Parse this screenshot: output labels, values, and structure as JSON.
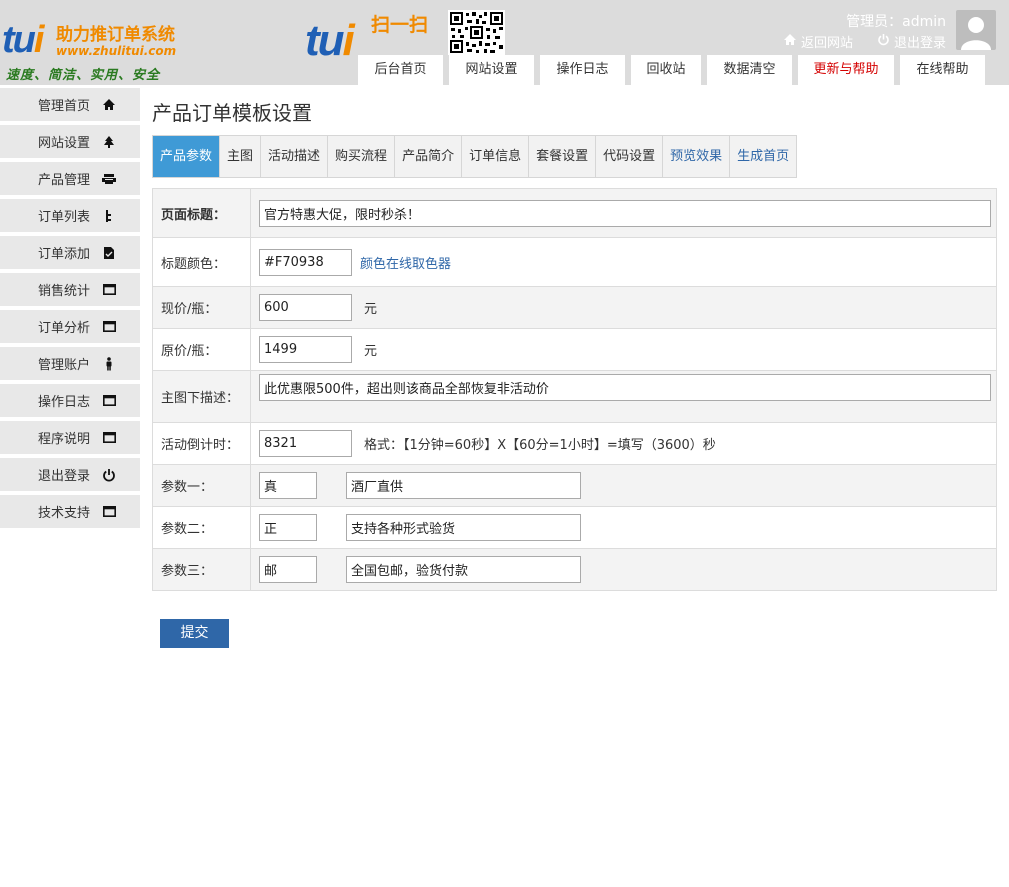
{
  "header": {
    "logo": {
      "brand": "tui",
      "title": "助力推订单系统",
      "url": "www.zhulitui.com",
      "slogan": "速度、简洁、实用、安全"
    },
    "scan": {
      "brand": "tui",
      "text": "扫一扫"
    },
    "admin_label": "管理员：admin",
    "return_site": "返回网站",
    "logout": "退出登录"
  },
  "topnav": [
    {
      "label": "后台首页"
    },
    {
      "label": "网站设置"
    },
    {
      "label": "操作日志"
    },
    {
      "label": "回收站"
    },
    {
      "label": "数据清空"
    },
    {
      "label": "更新与帮助",
      "color": "#d40000"
    },
    {
      "label": "在线帮助"
    }
  ],
  "sidebar": {
    "items": [
      {
        "label": "管理首页",
        "icon": "home-icon"
      },
      {
        "label": "网站设置",
        "icon": "settings-icon"
      },
      {
        "label": "产品管理",
        "icon": "product-icon"
      },
      {
        "label": "订单列表",
        "icon": "list-icon"
      },
      {
        "label": "订单添加",
        "icon": "add-doc-icon"
      },
      {
        "label": "销售统计",
        "icon": "window-icon"
      },
      {
        "label": "订单分析",
        "icon": "window-icon"
      },
      {
        "label": "管理账户",
        "icon": "user-icon"
      },
      {
        "label": "操作日志",
        "icon": "window-icon"
      },
      {
        "label": "程序说明",
        "icon": "window-icon"
      },
      {
        "label": "退出登录",
        "icon": "power-icon"
      },
      {
        "label": "技术支持",
        "icon": "window-icon"
      }
    ]
  },
  "main": {
    "title": "产品订单模板设置",
    "subtabs": [
      {
        "label": "产品参数",
        "active": true
      },
      {
        "label": "主图"
      },
      {
        "label": "活动描述"
      },
      {
        "label": "购买流程"
      },
      {
        "label": "产品简介"
      },
      {
        "label": "订单信息"
      },
      {
        "label": "套餐设置"
      },
      {
        "label": "代码设置"
      },
      {
        "label": "预览效果",
        "color": "#2f67a8"
      },
      {
        "label": "生成首页",
        "color": "#2f67a8"
      }
    ],
    "form": {
      "page_title_label": "页面标题：",
      "page_title_value": "官方特惠大促，限时秒杀！",
      "title_color_label": "标题颜色：",
      "title_color_value": "#F70938",
      "color_picker_link": "颜色在线取色器",
      "current_price_label": "现价/瓶：",
      "current_price_value": "600",
      "original_price_label": "原价/瓶：",
      "original_price_value": "1499",
      "currency_unit": "元",
      "desc_label": "主图下描述：",
      "desc_value": "此优惠限500件，超出则该商品全部恢复非活动价",
      "countdown_label": "活动倒计时：",
      "countdown_value": "8321",
      "countdown_hint": "格式：【1分钟=60秒】X【60分=1小时】=填写（3600）秒",
      "param1_label": "参数一：",
      "param1_key": "真",
      "param1_value": "酒厂直供",
      "param2_label": "参数二：",
      "param2_key": "正",
      "param2_value": "支持各种形式验货",
      "param3_label": "参数三：",
      "param3_key": "邮",
      "param3_value": "全国包邮，验货付款"
    },
    "submit_label": "提交"
  },
  "colors": {
    "accent": "#3f9ad6",
    "button": "#2f67a8",
    "header_bg": "#dcdcdc",
    "logo_blue": "#1f5fb5",
    "logo_orange": "#f08a00"
  }
}
